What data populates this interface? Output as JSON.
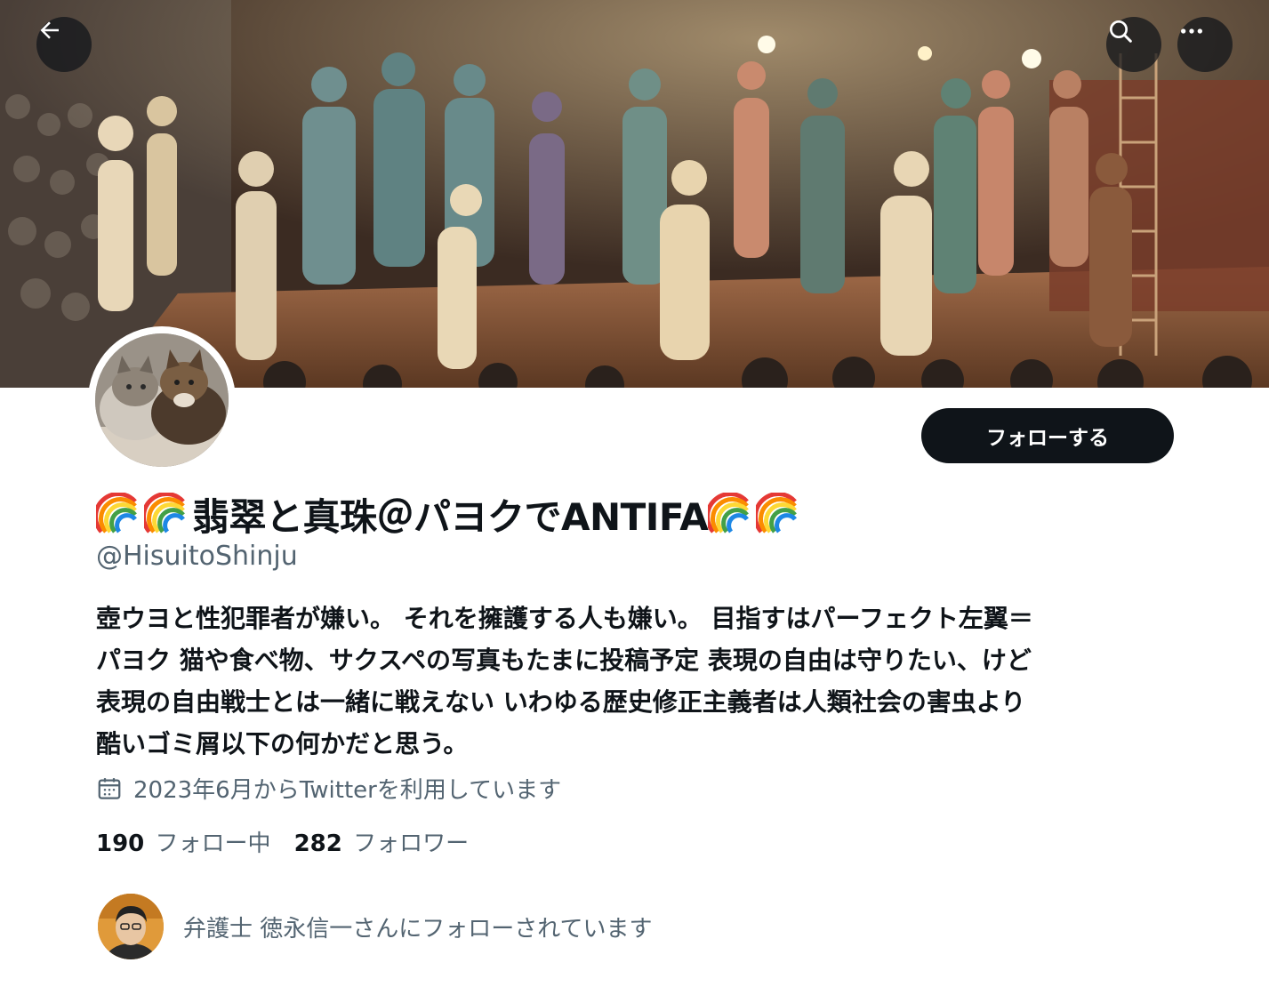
{
  "header": {
    "back_icon": "arrow-left-icon",
    "search_icon": "search-icon",
    "more_icon": "more-horizontal-icon"
  },
  "profile": {
    "display_name": "翡翠と真珠＠パヨクでANTIFA",
    "name_emoji": "rainbow-emoji",
    "handle": "@HisuitoShinju",
    "follow_button_label": "フォローする",
    "bio_lines": [
      "壺ウヨと性犯罪者が嫌い。 それを擁護する人も嫌い。 目指すはパーフェクト左翼＝",
      "パヨク 猫や食べ物、サクスペの写真もたまに投稿予定 表現の自由は守りたい、けど",
      "表現の自由戦士とは一緒に戦えない いわゆる歴史修正主義者は人類社会の害虫より",
      "酷いゴミ屑以下の何かだと思う。"
    ],
    "joined": "2023年6月からTwitterを利用しています",
    "following_count": "190",
    "following_label": "フォロー中",
    "followers_count": "282",
    "followers_label": "フォロワー",
    "followed_by": "弁護士 徳永信一さんにフォローされています"
  },
  "colors": {
    "primary_text": "#0f1419",
    "secondary_text": "#536471",
    "button_bg": "#0f1419",
    "button_text": "#ffffff"
  }
}
